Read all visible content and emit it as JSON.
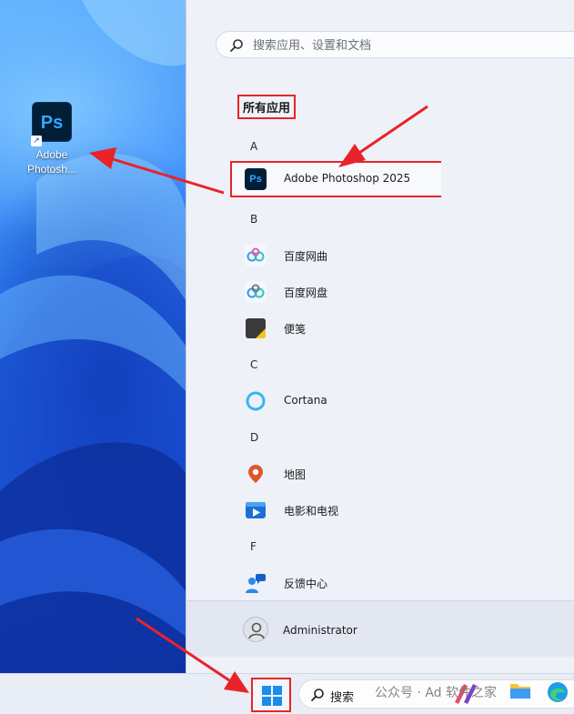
{
  "desktop": {
    "shortcut_icon": "photoshop-icon",
    "shortcut_glyph": "Ps",
    "shortcut_label": "Adobe\nPhotosh..."
  },
  "start_menu": {
    "search_placeholder": "搜索应用、设置和文档",
    "all_apps_title": "所有应用",
    "sections": [
      {
        "letter": "A",
        "apps": [
          {
            "label": "Adobe Photoshop 2025",
            "icon": "photoshop-icon",
            "glyph": "Ps"
          }
        ]
      },
      {
        "letter": "B",
        "apps": [
          {
            "label": "百度网曲",
            "icon": "baidu-netdisk-icon"
          },
          {
            "label": "百度网盘",
            "icon": "baidu-netdisk-icon"
          },
          {
            "label": "便笺",
            "icon": "sticky-notes-icon"
          }
        ]
      },
      {
        "letter": "C",
        "apps": [
          {
            "label": "Cortana",
            "icon": "cortana-icon"
          }
        ]
      },
      {
        "letter": "D",
        "apps": [
          {
            "label": "地图",
            "icon": "maps-icon"
          },
          {
            "label": "电影和电视",
            "icon": "movies-tv-icon"
          }
        ]
      },
      {
        "letter": "F",
        "apps": [
          {
            "label": "反馈中心",
            "icon": "feedback-hub-icon"
          }
        ]
      }
    ],
    "user_name": "Administrator"
  },
  "taskbar": {
    "search_label": "搜索",
    "watermark": "公众号 · Ad    软件之家"
  },
  "colors": {
    "highlight_red": "#e8232a",
    "photoshop_bg": "#001e36",
    "photoshop_blue": "#31a8ff"
  }
}
